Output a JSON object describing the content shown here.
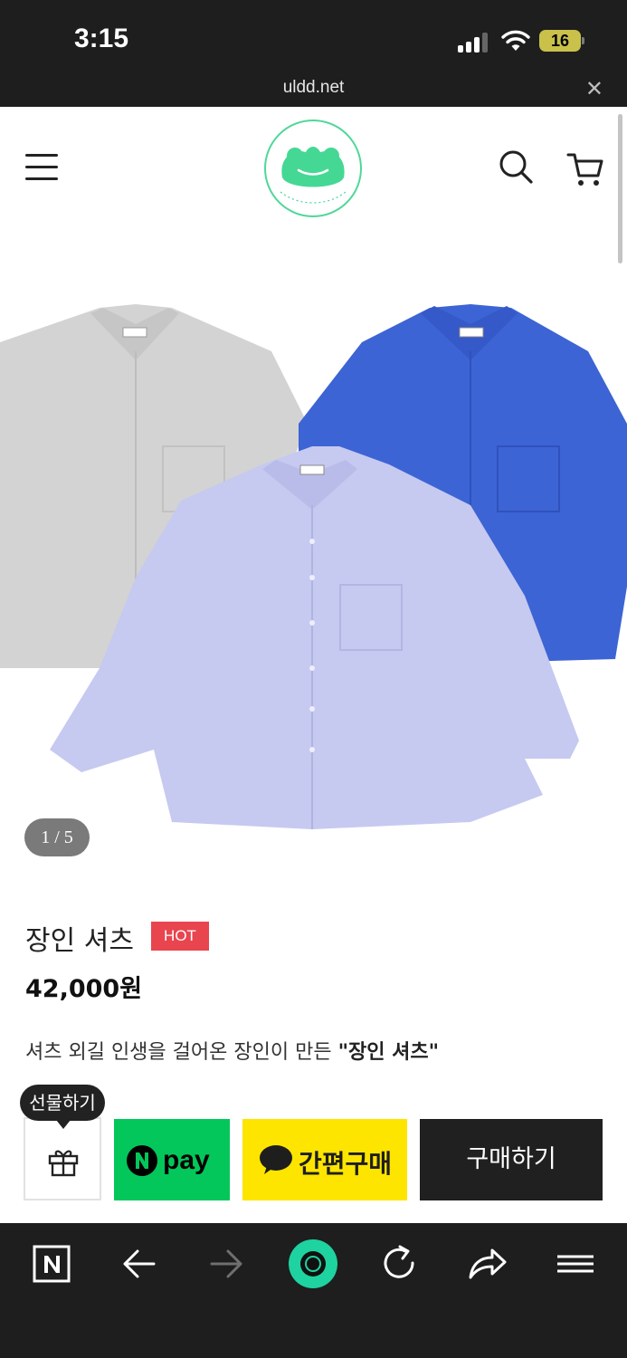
{
  "status_bar": {
    "time": "3:15",
    "battery": "16"
  },
  "url_bar": {
    "url": "uldd.net"
  },
  "gallery": {
    "counter": "1 / 5"
  },
  "product": {
    "title": "장인 셔츠",
    "badge": "HOT",
    "price": "42,000원",
    "description_prefix": "셔츠 외길 인생을 걸어온 장인이 만든 ",
    "description_bold": "\"장인 셔츠\""
  },
  "buy_bar": {
    "gift_tooltip": "선물하기",
    "kakao_label": "간편구매",
    "buy_label": "구매하기"
  },
  "colors": {
    "npay": "#03c75a",
    "kakao": "#fee500",
    "hot": "#e8454f",
    "buy": "#202020"
  }
}
